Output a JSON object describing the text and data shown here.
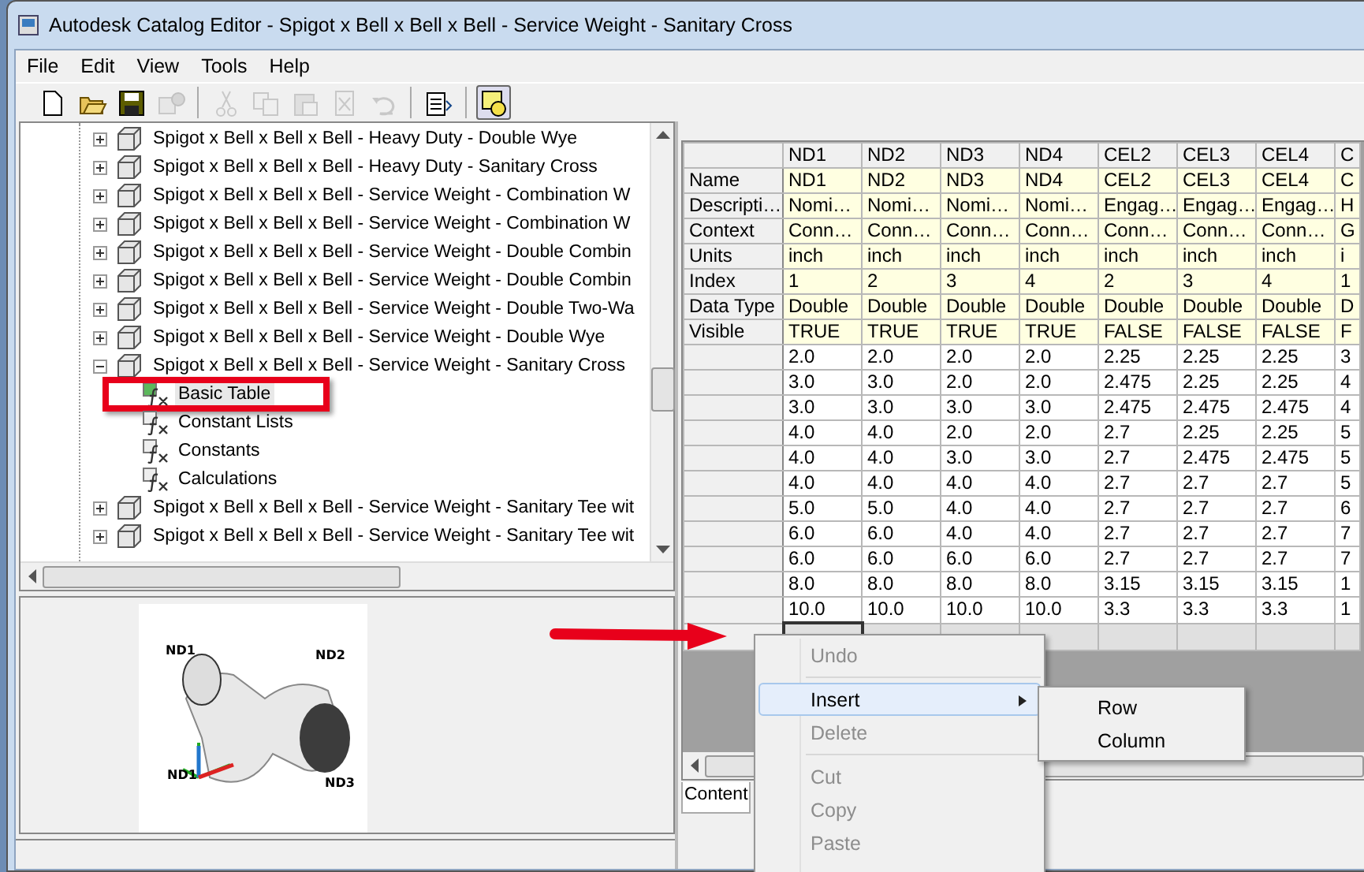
{
  "window": {
    "title": "Autodesk Catalog Editor - Spigot x Bell x Bell x Bell - Service Weight - Sanitary Cross"
  },
  "menu_bar": [
    "File",
    "Edit",
    "View",
    "Tools",
    "Help"
  ],
  "toolbar": [
    {
      "kind": "new",
      "disabled": false
    },
    {
      "kind": "open",
      "disabled": false
    },
    {
      "kind": "save",
      "disabled": false
    },
    {
      "kind": "publish",
      "disabled": true
    },
    {
      "kind": "separator"
    },
    {
      "kind": "cut",
      "disabled": true
    },
    {
      "kind": "copy",
      "disabled": true
    },
    {
      "kind": "paste",
      "disabled": true
    },
    {
      "kind": "delete",
      "disabled": true
    },
    {
      "kind": "undo",
      "disabled": true
    },
    {
      "kind": "separator"
    },
    {
      "kind": "properties",
      "disabled": false
    },
    {
      "kind": "separator"
    },
    {
      "kind": "preview",
      "disabled": false,
      "pressed": true
    }
  ],
  "tree": [
    {
      "label": "Spigot x Bell x Bell x Bell - Heavy Duty - Double Wye",
      "expanded": false
    },
    {
      "label": "Spigot x Bell x Bell x Bell - Heavy Duty - Sanitary Cross",
      "expanded": false
    },
    {
      "label": "Spigot x Bell x Bell x Bell - Service Weight - Combination W",
      "expanded": false
    },
    {
      "label": "Spigot x Bell x Bell x Bell - Service Weight - Combination W",
      "expanded": false
    },
    {
      "label": "Spigot x Bell x Bell x Bell - Service Weight - Double Combin",
      "expanded": false
    },
    {
      "label": "Spigot x Bell x Bell x Bell - Service Weight - Double Combin",
      "expanded": false
    },
    {
      "label": "Spigot x Bell x Bell x Bell - Service Weight - Double Two-Wa",
      "expanded": false
    },
    {
      "label": "Spigot x Bell x Bell x Bell - Service Weight - Double Wye",
      "expanded": false
    },
    {
      "label": "Spigot x Bell x Bell x Bell - Service Weight - Sanitary Cross",
      "expanded": true,
      "children": [
        {
          "label": "Basic Table",
          "selected": true,
          "annotated": true
        },
        {
          "label": "Constant Lists",
          "selected": false,
          "annotated": false
        },
        {
          "label": "Constants",
          "selected": false,
          "annotated": false
        },
        {
          "label": "Calculations",
          "selected": false,
          "annotated": false
        }
      ]
    },
    {
      "label": "Spigot x Bell x Bell x Bell - Service Weight - Sanitary Tee wit",
      "expanded": false
    },
    {
      "label": "Spigot x Bell x Bell x Bell - Service Weight - Sanitary Tee wit",
      "expanded": false
    }
  ],
  "preview": {
    "labels": [
      "ND1",
      "ND2",
      "ND1",
      "ND3"
    ]
  },
  "grid": {
    "columns": [
      "ND1",
      "ND2",
      "ND3",
      "ND4",
      "CEL2",
      "CEL3",
      "CEL4",
      "C"
    ],
    "property_rows": [
      {
        "label": "Name",
        "cells": [
          "ND1",
          "ND2",
          "ND3",
          "ND4",
          "CEL2",
          "CEL3",
          "CEL4",
          "C"
        ]
      },
      {
        "label": "Descripti…",
        "cells": [
          "Nomi…",
          "Nomi…",
          "Nomi…",
          "Nomi…",
          "Engag…",
          "Engag…",
          "Engag…",
          "H"
        ]
      },
      {
        "label": "Context",
        "cells": [
          "Conn…",
          "Conn…",
          "Conn…",
          "Conn…",
          "Conn…",
          "Conn…",
          "Conn…",
          "G"
        ]
      },
      {
        "label": "Units",
        "cells": [
          "inch",
          "inch",
          "inch",
          "inch",
          "inch",
          "inch",
          "inch",
          "i"
        ]
      },
      {
        "label": "Index",
        "cells": [
          "1",
          "2",
          "3",
          "4",
          "2",
          "3",
          "4",
          "1"
        ]
      },
      {
        "label": "Data Type",
        "cells": [
          "Double",
          "Double",
          "Double",
          "Double",
          "Double",
          "Double",
          "Double",
          "D"
        ]
      },
      {
        "label": "Visible",
        "cells": [
          "TRUE",
          "TRUE",
          "TRUE",
          "TRUE",
          "FALSE",
          "FALSE",
          "FALSE",
          "F"
        ]
      }
    ],
    "data_rows": [
      [
        "2.0",
        "2.0",
        "2.0",
        "2.0",
        "2.25",
        "2.25",
        "2.25",
        "3"
      ],
      [
        "3.0",
        "3.0",
        "2.0",
        "2.0",
        "2.475",
        "2.25",
        "2.25",
        "4"
      ],
      [
        "3.0",
        "3.0",
        "3.0",
        "3.0",
        "2.475",
        "2.475",
        "2.475",
        "4"
      ],
      [
        "4.0",
        "4.0",
        "2.0",
        "2.0",
        "2.7",
        "2.25",
        "2.25",
        "5"
      ],
      [
        "4.0",
        "4.0",
        "3.0",
        "3.0",
        "2.7",
        "2.475",
        "2.475",
        "5"
      ],
      [
        "4.0",
        "4.0",
        "4.0",
        "4.0",
        "2.7",
        "2.7",
        "2.7",
        "5"
      ],
      [
        "5.0",
        "5.0",
        "4.0",
        "4.0",
        "2.7",
        "2.7",
        "2.7",
        "6"
      ],
      [
        "6.0",
        "6.0",
        "4.0",
        "4.0",
        "2.7",
        "2.7",
        "2.7",
        "7"
      ],
      [
        "6.0",
        "6.0",
        "6.0",
        "6.0",
        "2.7",
        "2.7",
        "2.7",
        "7"
      ],
      [
        "8.0",
        "8.0",
        "8.0",
        "8.0",
        "3.15",
        "3.15",
        "3.15",
        "1"
      ],
      [
        "10.0",
        "10.0",
        "10.0",
        "10.0",
        "3.3",
        "3.3",
        "3.3",
        "1"
      ]
    ]
  },
  "tabs": [
    {
      "label": "Content",
      "selected": true
    }
  ],
  "context_menu": [
    {
      "kind": "item",
      "label": "Undo",
      "disabled": true,
      "highlighted": false
    },
    {
      "kind": "separator"
    },
    {
      "kind": "item",
      "label": "Insert",
      "disabled": false,
      "highlighted": true,
      "submenu": [
        "Row",
        "Column"
      ]
    },
    {
      "kind": "item",
      "label": "Delete",
      "disabled": true,
      "highlighted": false
    },
    {
      "kind": "separator"
    },
    {
      "kind": "item",
      "label": "Cut",
      "disabled": true,
      "highlighted": false
    },
    {
      "kind": "item",
      "label": "Copy",
      "disabled": true,
      "highlighted": false
    },
    {
      "kind": "item",
      "label": "Paste",
      "disabled": true,
      "highlighted": false
    }
  ],
  "annotation_arrow": true
}
